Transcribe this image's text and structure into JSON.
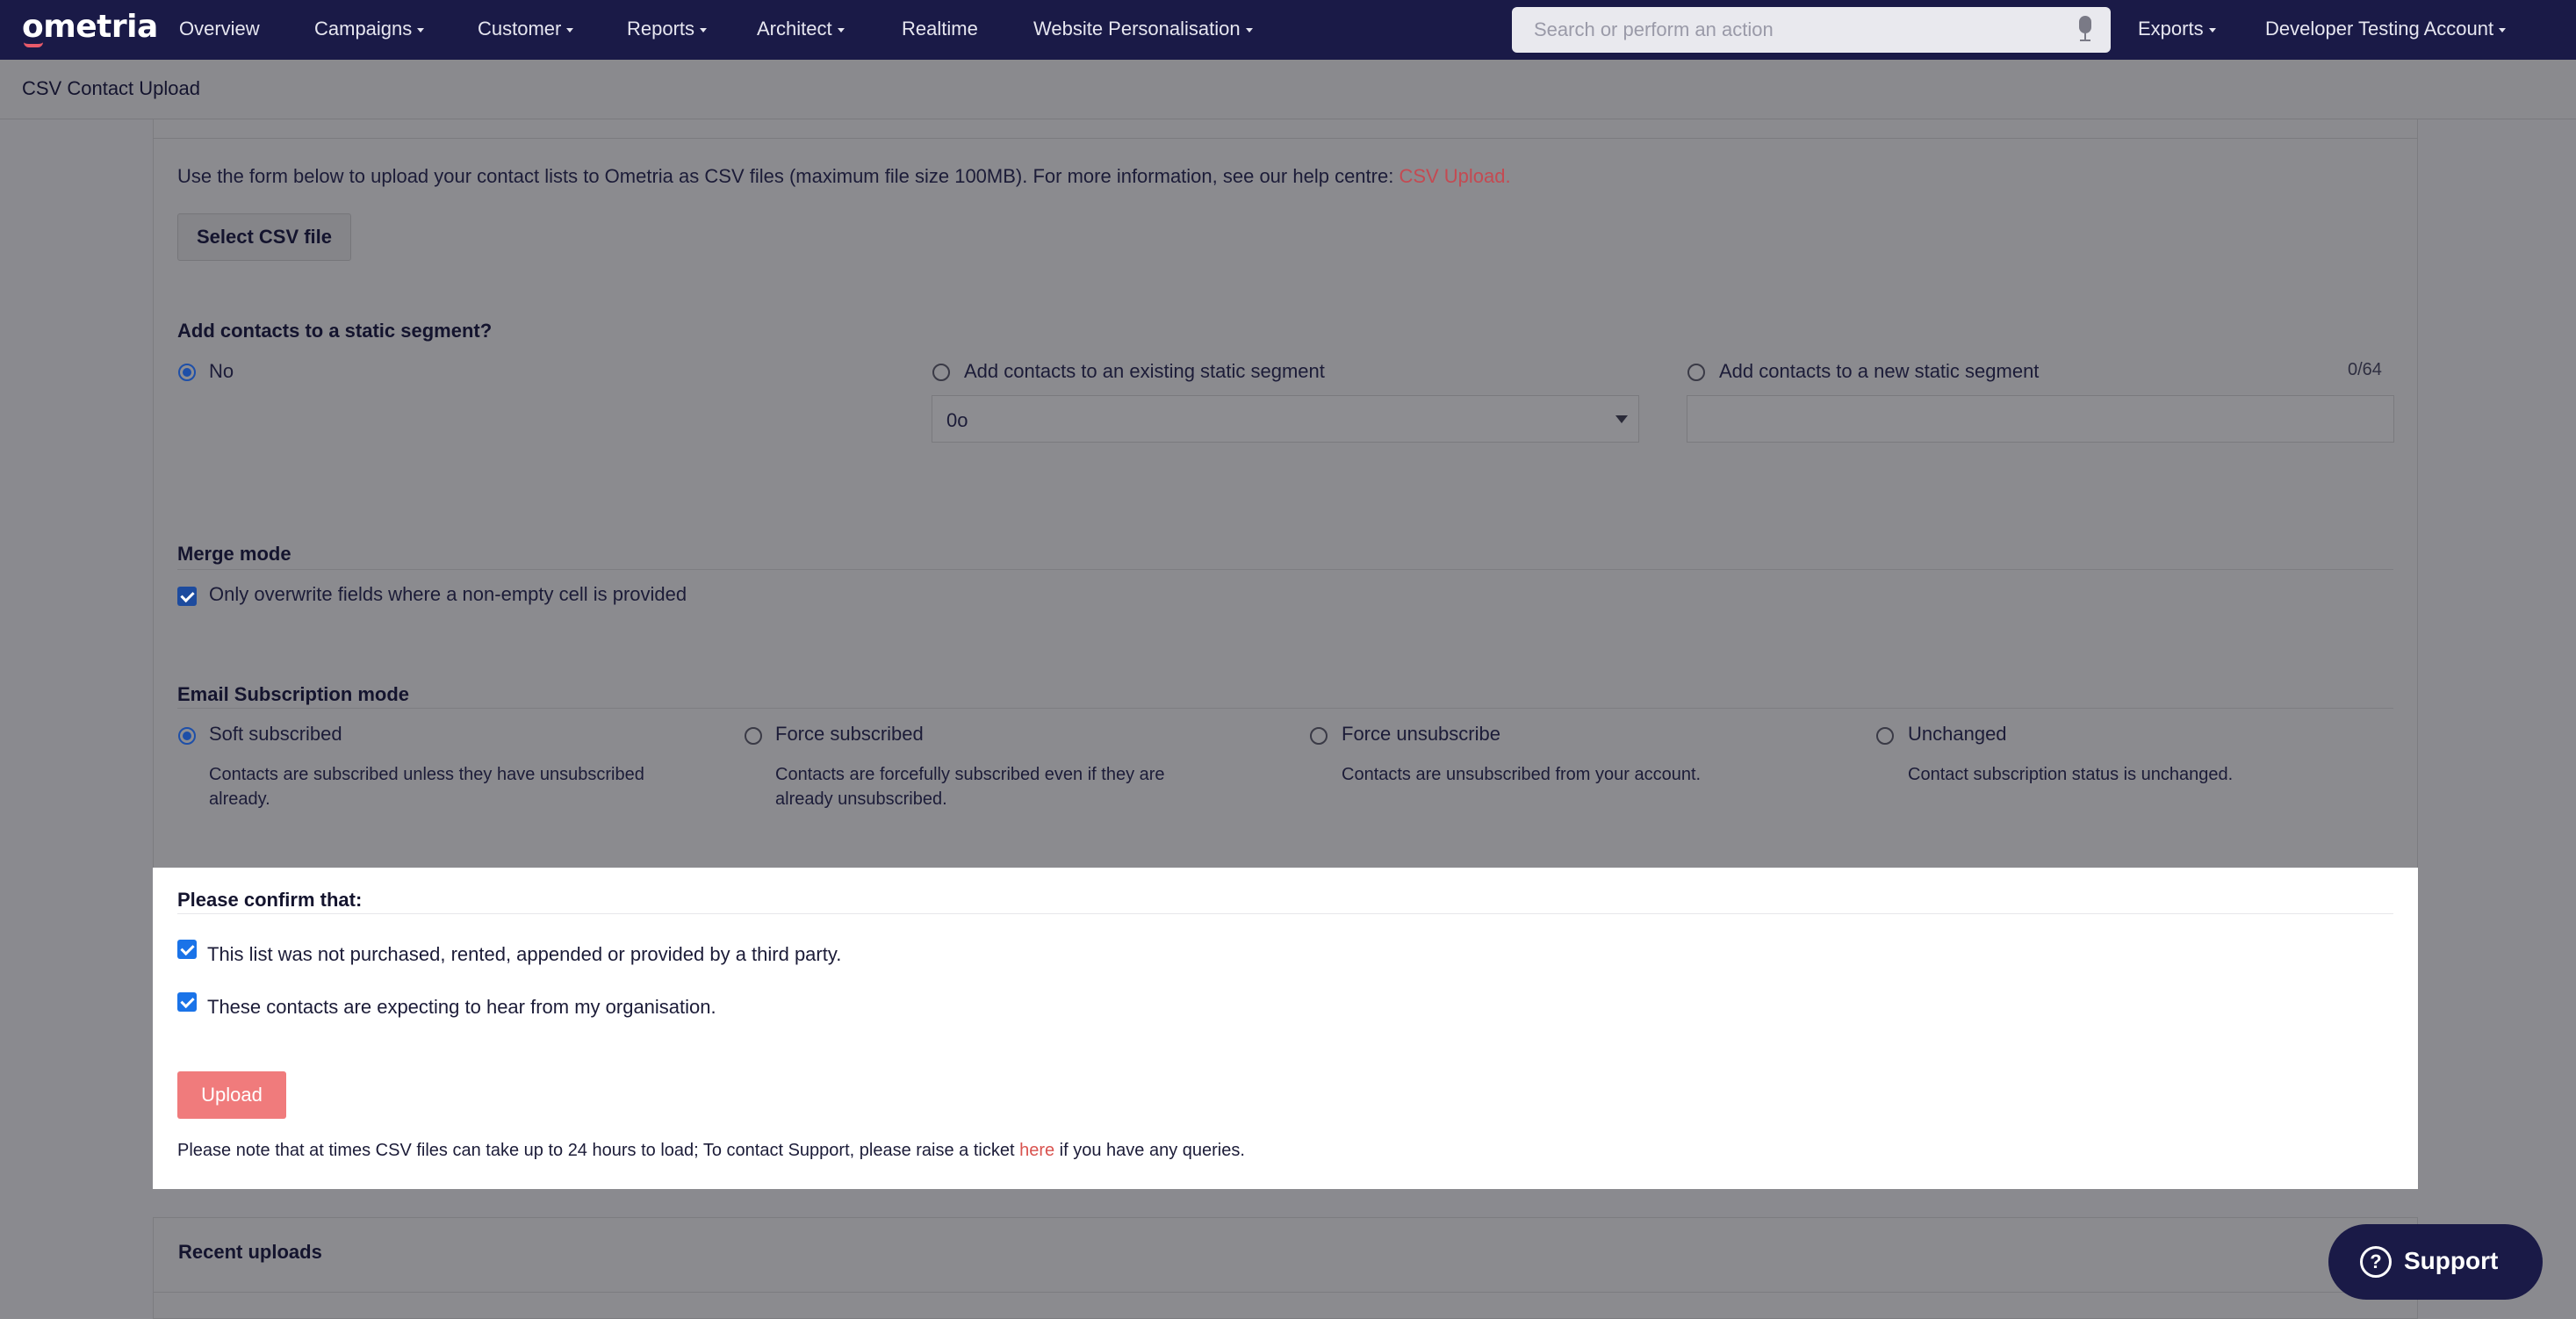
{
  "nav": {
    "logo": "ometria",
    "items": [
      "Overview",
      "Campaigns",
      "Customer",
      "Reports",
      "Architect",
      "Realtime",
      "Website Personalisation"
    ],
    "search_placeholder": "Search or perform an action",
    "exports": "Exports",
    "account": "Developer Testing Account"
  },
  "page": {
    "title": "CSV Contact Upload"
  },
  "upload": {
    "intro": "Use the form below to upload your contact lists to Ometria as CSV files (maximum file size 100MB). For more information, see our help centre: ",
    "intro_link": "CSV Upload.",
    "select_button": "Select CSV file"
  },
  "segment": {
    "title": "Add contacts to a static segment?",
    "options": [
      "No",
      "Add contacts to an existing static segment",
      "Add contacts to a new static segment"
    ],
    "selected": "No",
    "existing_select_value": "0o",
    "new_counter": "0/64"
  },
  "merge": {
    "title": "Merge mode",
    "option": "Only overwrite fields where a non-empty cell is provided",
    "checked": true
  },
  "subscription": {
    "title": "Email Subscription mode",
    "selected": "Soft subscribed",
    "options": [
      {
        "label": "Soft subscribed",
        "desc1": "Contacts are subscribed unless they have unsubscribed",
        "desc2": "already."
      },
      {
        "label": "Force subscribed",
        "desc1": "Contacts are forcefully subscribed even if they are",
        "desc2": "already unsubscribed."
      },
      {
        "label": "Force unsubscribe",
        "desc1": "Contacts are unsubscribed from your account.",
        "desc2": ""
      },
      {
        "label": "Unchanged",
        "desc1": "Contact subscription status is unchanged.",
        "desc2": ""
      }
    ]
  },
  "confirm": {
    "title": "Please confirm that:",
    "items": [
      "This list was not purchased, rented, appended or provided by a third party.",
      "These contacts are expecting to hear from my organisation."
    ],
    "upload_button": "Upload",
    "note_before": "Please note that at times CSV files can take up to 24 hours to load; To contact Support, please raise a ticket ",
    "note_link": "here",
    "note_after": " if you have any queries."
  },
  "recent": {
    "title": "Recent uploads"
  },
  "support": {
    "label": "Support"
  },
  "colors": {
    "nav_bg": "#1a1a47",
    "accent_red": "#f07b7c",
    "link_red": "#d9534f",
    "checkbox_blue": "#1a73e8"
  }
}
